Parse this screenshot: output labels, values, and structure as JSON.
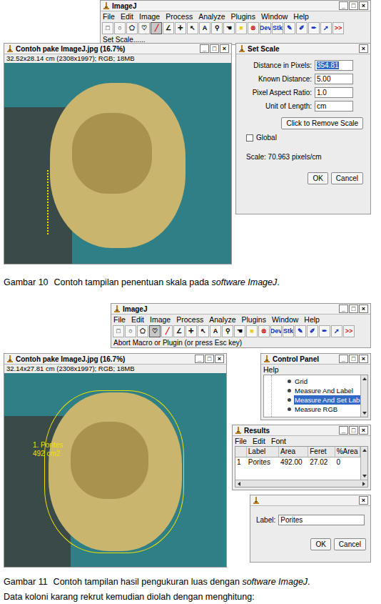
{
  "window_buttons": [
    "_",
    "□",
    "×"
  ],
  "figure_10": {
    "main_window": {
      "title": "ImageJ",
      "menu": [
        "File",
        "Edit",
        "Image",
        "Process",
        "Analyze",
        "Plugins",
        "Window",
        "Help"
      ],
      "toolbar": [
        {
          "glyph": "□",
          "selected": false,
          "color": "#000000"
        },
        {
          "glyph": "○",
          "selected": false,
          "color": "#000000"
        },
        {
          "glyph": "⬠",
          "selected": false,
          "color": "#000000"
        },
        {
          "glyph": "♡",
          "selected": false,
          "color": "#000000"
        },
        {
          "glyph": "╱",
          "selected": true,
          "color": "#d01010"
        },
        {
          "glyph": "∠",
          "selected": false,
          "color": "#000000"
        },
        {
          "glyph": "✛",
          "selected": false,
          "color": "#000000"
        },
        {
          "glyph": "↖",
          "selected": false,
          "color": "#000000"
        },
        {
          "glyph": "A",
          "selected": false,
          "color": "#000000"
        },
        {
          "glyph": "⚲",
          "selected": false,
          "color": "#000000"
        },
        {
          "glyph": "☚",
          "selected": false,
          "color": "#000000"
        },
        {
          "glyph": "■",
          "selected": false,
          "color": "#e8d020"
        },
        {
          "glyph": "⊗",
          "selected": false,
          "color": "#d01010"
        },
        {
          "glyph": "Dev",
          "selected": false,
          "color": "#1030c0"
        },
        {
          "glyph": "Stk",
          "selected": false,
          "color": "#1030c0"
        },
        {
          "glyph": "✎",
          "selected": false,
          "color": "#1030c0"
        },
        {
          "glyph": "✐",
          "selected": false,
          "color": "#1030c0"
        },
        {
          "glyph": "✒",
          "selected": false,
          "color": "#1030c0"
        },
        {
          "glyph": "➚",
          "selected": false,
          "color": "#1030c0"
        },
        {
          "glyph": ">>",
          "selected": false,
          "color": "#d01010"
        }
      ],
      "status": "Set Scale......"
    },
    "image_window": {
      "title": "Contoh pake ImageJ.jpg (16.7%)",
      "info": "32.52x28.14 cm (2308x1997); RGB; 18MB"
    },
    "set_scale": {
      "title": "Set Scale",
      "close": "×",
      "fields": [
        {
          "label": "Distance in Pixels:",
          "value": "354.81",
          "selected": true
        },
        {
          "label": "Known Distance:",
          "value": "5.00",
          "selected": false
        },
        {
          "label": "Pixel Aspect Ratio:",
          "value": "1.0",
          "selected": false
        },
        {
          "label": "Unit of Length:",
          "value": "cm",
          "selected": false
        }
      ],
      "remove_button": "Click to Remove Scale",
      "global": {
        "label": "Global",
        "checked": false
      },
      "scale": "Scale: 70.963 pixels/cm",
      "buttons": [
        "OK",
        "Cancel"
      ]
    },
    "caption": {
      "number": "Gambar 10",
      "text": "Contoh tampilan penentuan skala pada ",
      "italic": "software ImageJ",
      "end": "."
    }
  },
  "figure_11": {
    "main_window": {
      "title": "ImageJ",
      "menu": [
        "File",
        "Edit",
        "Image",
        "Process",
        "Analyze",
        "Plugins",
        "Window",
        "Help"
      ],
      "toolbar": [
        {
          "glyph": "□",
          "selected": false,
          "color": "#000000"
        },
        {
          "glyph": "○",
          "selected": false,
          "color": "#000000"
        },
        {
          "glyph": "⬠",
          "selected": false,
          "color": "#000000"
        },
        {
          "glyph": "♡",
          "selected": true,
          "color": "#000000"
        },
        {
          "glyph": "╱",
          "selected": false,
          "color": "#d01010"
        },
        {
          "glyph": "∠",
          "selected": false,
          "color": "#000000"
        },
        {
          "glyph": "✛",
          "selected": false,
          "color": "#000000"
        },
        {
          "glyph": "↖",
          "selected": false,
          "color": "#000000"
        },
        {
          "glyph": "A",
          "selected": false,
          "color": "#000000"
        },
        {
          "glyph": "⚲",
          "selected": false,
          "color": "#000000"
        },
        {
          "glyph": "☚",
          "selected": false,
          "color": "#000000"
        },
        {
          "glyph": "■",
          "selected": false,
          "color": "#e8d020"
        },
        {
          "glyph": "⊗",
          "selected": false,
          "color": "#d01010"
        },
        {
          "glyph": "Dev",
          "selected": false,
          "color": "#1030c0"
        },
        {
          "glyph": "Stk",
          "selected": false,
          "color": "#1030c0"
        },
        {
          "glyph": "✎",
          "selected": false,
          "color": "#1030c0"
        },
        {
          "glyph": "✐",
          "selected": false,
          "color": "#1030c0"
        },
        {
          "glyph": "✒",
          "selected": false,
          "color": "#1030c0"
        },
        {
          "glyph": "➚",
          "selected": false,
          "color": "#1030c0"
        },
        {
          "glyph": ">>",
          "selected": false,
          "color": "#d01010"
        }
      ],
      "status": "Abort Macro or Plugin (or press Esc key)"
    },
    "image_window": {
      "title": "Contoh pake ImageJ.jpg (16.7%)",
      "info": "32.14x27.81 cm (2308x1997); RGB; 18MB",
      "overlay": [
        "1. Porites",
        "492 cm2"
      ]
    },
    "control_panel": {
      "title": "Control Panel",
      "menu": [
        "Help"
      ],
      "items": [
        {
          "label": "Grid",
          "selected": false
        },
        {
          "label": "Measure And Label",
          "selected": false
        },
        {
          "label": "Measure And Set Label",
          "selected": true
        },
        {
          "label": "Measure RGB",
          "selected": false
        }
      ]
    },
    "results": {
      "title": "Results",
      "menu": [
        "File",
        "Edit",
        "Font"
      ],
      "columns": [
        "",
        "Label",
        "Area",
        "Feret",
        "%Area"
      ],
      "rows": [
        [
          "1",
          "Porites",
          "492.00",
          "27.02",
          "0"
        ]
      ]
    },
    "label_dialog": {
      "close": "×",
      "label": "Label:",
      "value": "Porites",
      "buttons": [
        "OK",
        "Cancel"
      ]
    },
    "caption": {
      "number": "Gambar 11",
      "text": "Contoh tampilan hasil pengukuran luas dengan ",
      "italic": "software ImageJ",
      "end": "."
    }
  },
  "body_text": "Data koloni karang rekrut kemudian diolah dengan menghitung:"
}
